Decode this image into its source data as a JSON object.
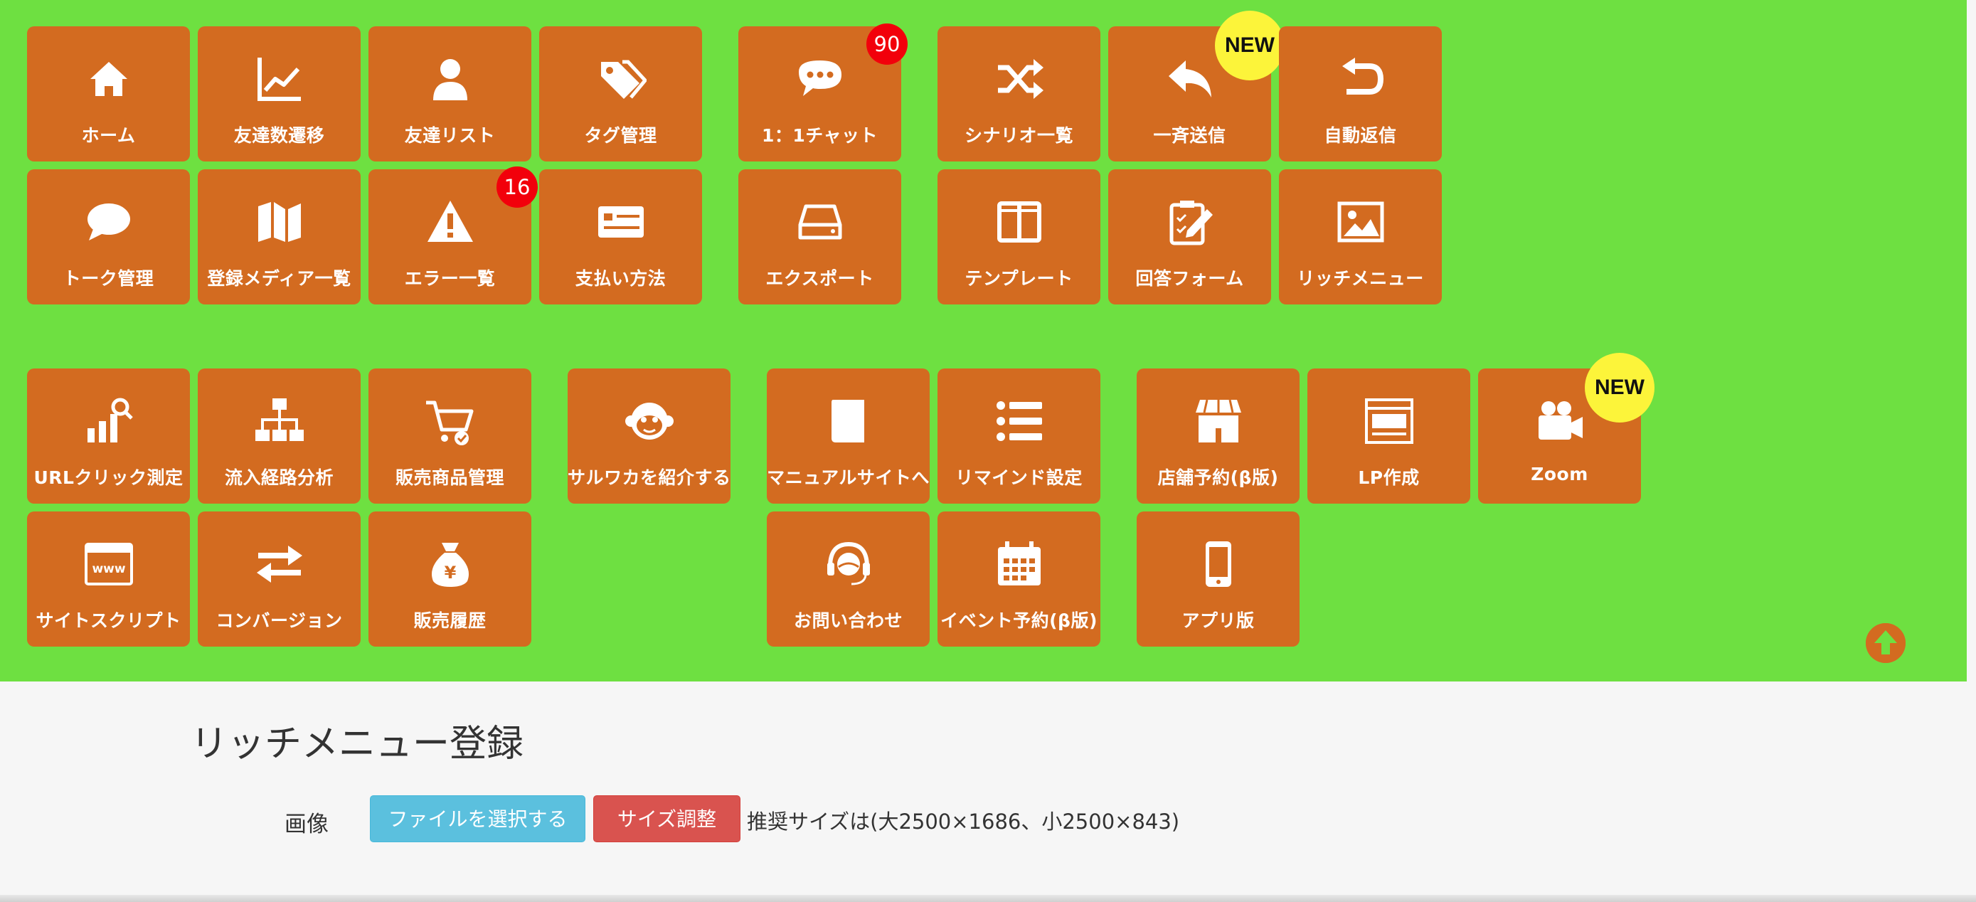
{
  "colors": {
    "nav_background": "#6ee041",
    "tile": "#d36b20",
    "count_badge": "#f2000b",
    "new_badge": "#fcf43a",
    "file_button": "#5bc0de",
    "resize_button": "#d9534f"
  },
  "nav": {
    "tiles": [
      {
        "label": "ホーム",
        "icon": "home-icon"
      },
      {
        "label": "友達数遷移",
        "icon": "line-chart-icon"
      },
      {
        "label": "友達リスト",
        "icon": "user-icon"
      },
      {
        "label": "タグ管理",
        "icon": "tags-icon"
      },
      {
        "label": "1：1チャット",
        "icon": "chat-dots-icon",
        "badge": "90"
      },
      {
        "label": "シナリオ一覧",
        "icon": "shuffle-icon"
      },
      {
        "label": "一斉送信",
        "icon": "reply-icon",
        "new_badge": "NEW"
      },
      {
        "label": "自動返信",
        "icon": "undo-icon"
      },
      {
        "label": "トーク管理",
        "icon": "speech-bubble-icon"
      },
      {
        "label": "登録メディア一覧",
        "icon": "map-icon"
      },
      {
        "label": "エラー一覧",
        "icon": "warning-icon",
        "badge": "16"
      },
      {
        "label": "支払い方法",
        "icon": "credit-card-icon"
      },
      {
        "label": "エクスポート",
        "icon": "drive-icon"
      },
      {
        "label": "テンプレート",
        "icon": "columns-icon"
      },
      {
        "label": "回答フォーム",
        "icon": "clipboard-edit-icon"
      },
      {
        "label": "リッチメニュー",
        "icon": "image-icon"
      },
      {
        "label": "URLクリック測定",
        "icon": "chart-search-icon"
      },
      {
        "label": "流入経路分析",
        "icon": "sitemap-icon"
      },
      {
        "label": "販売商品管理",
        "icon": "cart-icon"
      },
      {
        "label": "サルワカを紹介する",
        "icon": "monkey-icon"
      },
      {
        "label": "マニュアルサイトへ",
        "icon": "book-icon"
      },
      {
        "label": "リマインド設定",
        "icon": "list-icon"
      },
      {
        "label": "店舗予約(β版)",
        "icon": "store-icon"
      },
      {
        "label": "LP作成",
        "icon": "webpage-icon"
      },
      {
        "label": "Zoom",
        "icon": "video-camera-icon",
        "new_badge": "NEW"
      },
      {
        "label": "サイトスクリプト",
        "icon": "www-icon"
      },
      {
        "label": "コンバージョン",
        "icon": "exchange-icon"
      },
      {
        "label": "販売履歴",
        "icon": "money-bag-icon"
      },
      {
        "label": "お問い合わせ",
        "icon": "headset-icon"
      },
      {
        "label": "イベント予約(β版)",
        "icon": "calendar-icon"
      },
      {
        "label": "アプリ版",
        "icon": "mobile-icon"
      }
    ],
    "scroll_top_icon": "arrow-up-circle-icon"
  },
  "main": {
    "title": "リッチメニュー登録",
    "image_field": {
      "label": "画像",
      "file_button": "ファイルを選択する",
      "resize_button": "サイズ調整",
      "hint": "推奨サイズは(大2500×1686、小2500×843)"
    }
  }
}
